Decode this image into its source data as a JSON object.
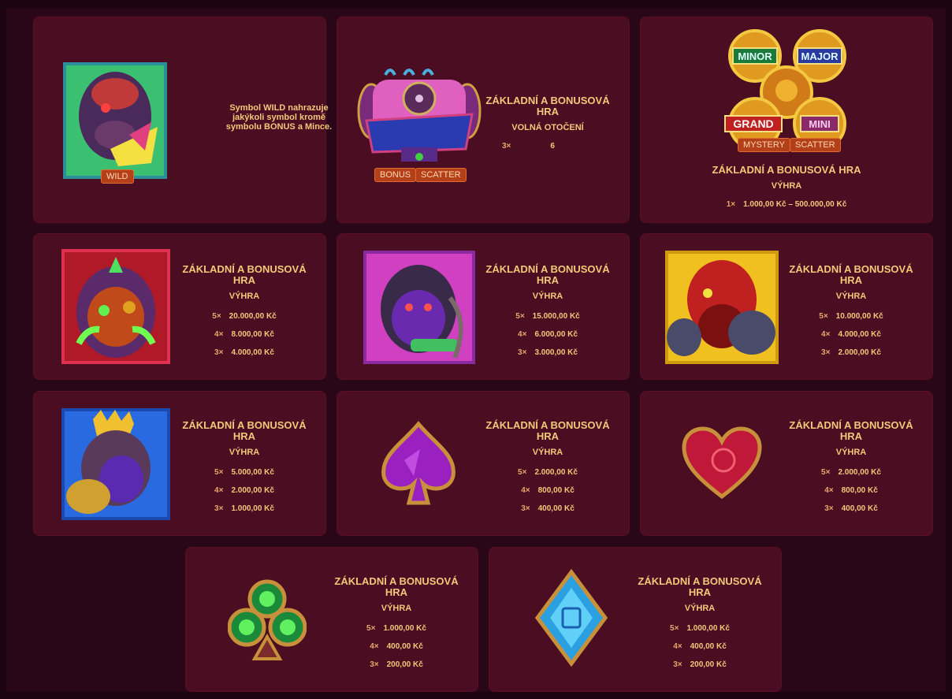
{
  "wild": {
    "description": "Symbol WILD nahrazuje jakýkoli symbol kromě symbolu BONUS a Mince.",
    "tag": "WILD",
    "icon": "wild-gorilla-icon"
  },
  "bonus": {
    "title": "ZÁKLADNÍ A BONUSOVÁ HRA",
    "subtitle": "VOLNÁ OTOČENÍ",
    "lines": [
      {
        "mult": "3×",
        "value": "6"
      }
    ],
    "tags": [
      "BONUS",
      "SCATTER"
    ],
    "icon": "bonus-barrel-icon"
  },
  "mystery": {
    "title": "ZÁKLADNÍ A BONUSOVÁ HRA",
    "subtitle": "VÝHRA",
    "lines": [
      {
        "mult": "1×",
        "value": "1.000,00 Kč – 500.000,00 Kč"
      }
    ],
    "tags": [
      "MYSTERY",
      "SCATTER"
    ],
    "coins": [
      "MINOR",
      "MAJOR",
      "GRAND",
      "MINI"
    ]
  },
  "symbols": [
    {
      "icon": "orange-gorilla-icon",
      "title": "ZÁKLADNÍ A BONUSOVÁ HRA",
      "subtitle": "VÝHRA",
      "lines": [
        {
          "mult": "5×",
          "value": "20.000,00 Kč"
        },
        {
          "mult": "4×",
          "value": "8.000,00 Kč"
        },
        {
          "mult": "3×",
          "value": "4.000,00 Kč"
        }
      ]
    },
    {
      "icon": "purple-gorilla-icon",
      "title": "ZÁKLADNÍ A BONUSOVÁ HRA",
      "subtitle": "VÝHRA",
      "lines": [
        {
          "mult": "5×",
          "value": "15.000,00 Kč"
        },
        {
          "mult": "4×",
          "value": "6.000,00 Kč"
        },
        {
          "mult": "3×",
          "value": "3.000,00 Kč"
        }
      ]
    },
    {
      "icon": "red-gorilla-icon",
      "title": "ZÁKLADNÍ A BONUSOVÁ HRA",
      "subtitle": "VÝHRA",
      "lines": [
        {
          "mult": "5×",
          "value": "10.000,00 Kč"
        },
        {
          "mult": "4×",
          "value": "4.000,00 Kč"
        },
        {
          "mult": "3×",
          "value": "2.000,00 Kč"
        }
      ]
    },
    {
      "icon": "blue-gorilla-icon",
      "title": "ZÁKLADNÍ A BONUSOVÁ HRA",
      "subtitle": "VÝHRA",
      "lines": [
        {
          "mult": "5×",
          "value": "5.000,00 Kč"
        },
        {
          "mult": "4×",
          "value": "2.000,00 Kč"
        },
        {
          "mult": "3×",
          "value": "1.000,00 Kč"
        }
      ]
    },
    {
      "icon": "spade-icon",
      "title": "ZÁKLADNÍ A BONUSOVÁ HRA",
      "subtitle": "VÝHRA",
      "lines": [
        {
          "mult": "5×",
          "value": "2.000,00 Kč"
        },
        {
          "mult": "4×",
          "value": "800,00 Kč"
        },
        {
          "mult": "3×",
          "value": "400,00 Kč"
        }
      ]
    },
    {
      "icon": "heart-icon",
      "title": "ZÁKLADNÍ A BONUSOVÁ HRA",
      "subtitle": "VÝHRA",
      "lines": [
        {
          "mult": "5×",
          "value": "2.000,00 Kč"
        },
        {
          "mult": "4×",
          "value": "800,00 Kč"
        },
        {
          "mult": "3×",
          "value": "400,00 Kč"
        }
      ]
    },
    {
      "icon": "club-icon",
      "title": "ZÁKLADNÍ A BONUSOVÁ HRA",
      "subtitle": "VÝHRA",
      "lines": [
        {
          "mult": "5×",
          "value": "1.000,00 Kč"
        },
        {
          "mult": "4×",
          "value": "400,00 Kč"
        },
        {
          "mult": "3×",
          "value": "200,00 Kč"
        }
      ]
    },
    {
      "icon": "diamond-icon",
      "title": "ZÁKLADNÍ A BONUSOVÁ HRA",
      "subtitle": "VÝHRA",
      "lines": [
        {
          "mult": "5×",
          "value": "1.000,00 Kč"
        },
        {
          "mult": "4×",
          "value": "400,00 Kč"
        },
        {
          "mult": "3×",
          "value": "200,00 Kč"
        }
      ]
    }
  ]
}
